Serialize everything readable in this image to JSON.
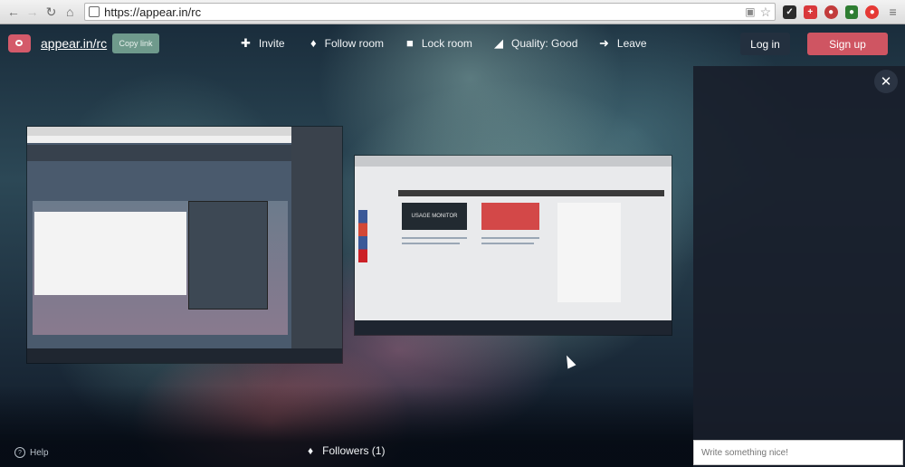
{
  "browser": {
    "url": "https://appear.in/rc"
  },
  "header": {
    "logo_text": "appear.in/rc",
    "copy_link": "Copy link",
    "actions": [
      {
        "icon": "plus-icon",
        "label": "Invite"
      },
      {
        "icon": "bell-icon",
        "label": "Follow room"
      },
      {
        "icon": "lock-icon",
        "label": "Lock room"
      },
      {
        "icon": "signal-quality-icon",
        "label": "Quality: Good"
      },
      {
        "icon": "leave-icon",
        "label": "Leave"
      }
    ],
    "login": "Log in",
    "signup": "Sign up"
  },
  "chat": {
    "placeholder": "Write something nice!"
  },
  "footer": {
    "help": "Help",
    "followers": "Followers (1)"
  },
  "tile_b": {
    "card1_text": "USAGE MONITOR"
  }
}
